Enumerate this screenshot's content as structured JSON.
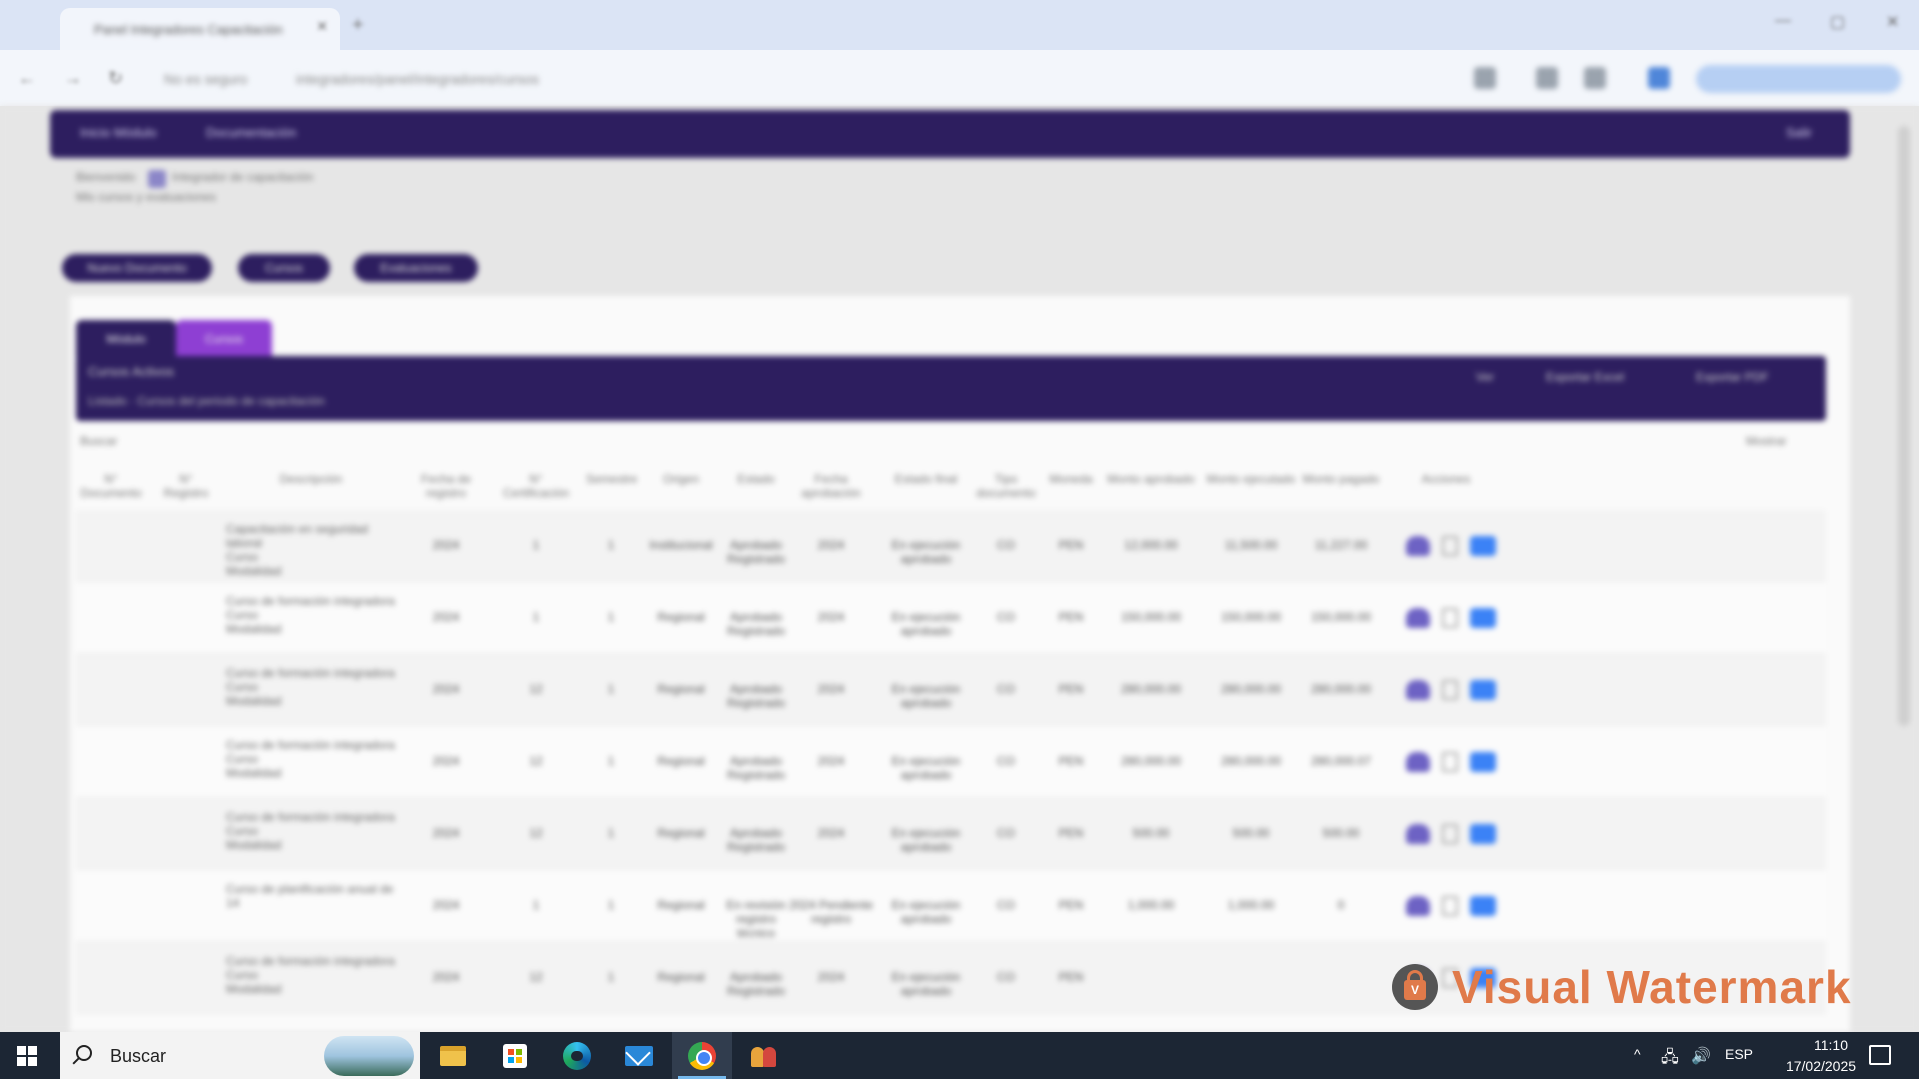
{
  "browser": {
    "tab_title": "Panel Integradores Capacitación",
    "tab_close": "✕",
    "new_tab": "+",
    "window_controls": [
      "—",
      "▢",
      "✕"
    ],
    "nav": {
      "back": "←",
      "forward": "→",
      "reload": "↻"
    },
    "url_prefix": "No es seguro",
    "url": "integradores/panel/integradores/cursos"
  },
  "app": {
    "nav_items": [
      "Inicio Módulo",
      "Documentación"
    ],
    "nav_right": "Salir",
    "info_lines": [
      "Bienvenido",
      "Integrador de capacitación",
      "Mis cursos y evaluaciones"
    ],
    "action_buttons": [
      "Nuevo Documento",
      "Cursos",
      "Evaluaciones"
    ],
    "subtabs": [
      "Módulo",
      "Cursos"
    ],
    "banner_title": "Cursos Activos",
    "banner_subtitle": "Listado · Cursos del periodo de capacitación",
    "banner_actions": [
      "Ver",
      "Exportar Excel",
      "Exportar PDF"
    ],
    "filter_label": "Buscar",
    "filter_right": "Mostrar",
    "headers": [
      "N° Documento",
      "N° Registro",
      "Descripción",
      "Fecha de registro",
      "N° Certificación",
      "Semestre",
      "Origen",
      "Estado",
      "Fecha aprobación",
      "Estado final",
      "Tipo documento",
      "Moneda",
      "Monto aprobado",
      "Monto ejecutado",
      "Monto pagado",
      "Acciones"
    ],
    "rows": [
      {
        "desc": [
          "Capacitación en seguridad laboral",
          "Curso",
          "Modalidad"
        ],
        "fecha": "2024",
        "cert": "1",
        "sem": "1",
        "origen": "Institucional",
        "estado": "Aprobado Registrado",
        "fecha_ap": "2024",
        "estado_final": "En ejecución aprobado",
        "tipo": "CO",
        "moneda": "PEN",
        "m1": "12,000.00",
        "m2": "11,500.00",
        "m3": "11,227.00"
      },
      {
        "desc": [
          "Curso de formación integradora",
          "Curso",
          "Modalidad"
        ],
        "fecha": "2024",
        "cert": "1",
        "sem": "1",
        "origen": "Regional",
        "estado": "Aprobado Registrado",
        "fecha_ap": "2024",
        "estado_final": "En ejecución aprobado",
        "tipo": "CO",
        "moneda": "PEN",
        "m1": "150,000.00",
        "m2": "150,000.00",
        "m3": "150,000.00"
      },
      {
        "desc": [
          "Curso de formación integradora",
          "Curso",
          "Modalidad"
        ],
        "fecha": "2024",
        "cert": "12",
        "sem": "1",
        "origen": "Regional",
        "estado": "Aprobado Registrado",
        "fecha_ap": "2024",
        "estado_final": "En ejecución aprobado",
        "tipo": "CO",
        "moneda": "PEN",
        "m1": "280,000.00",
        "m2": "280,000.00",
        "m3": "280,000.00"
      },
      {
        "desc": [
          "Curso de formación integradora",
          "Curso",
          "Modalidad"
        ],
        "fecha": "2024",
        "cert": "12",
        "sem": "1",
        "origen": "Regional",
        "estado": "Aprobado Registrado",
        "fecha_ap": "2024",
        "estado_final": "En ejecución aprobado",
        "tipo": "CO",
        "moneda": "PEN",
        "m1": "280,000.00",
        "m2": "280,000.00",
        "m3": "280,000.07"
      },
      {
        "desc": [
          "Curso de formación integradora",
          "Curso",
          "Modalidad"
        ],
        "fecha": "2024",
        "cert": "12",
        "sem": "1",
        "origen": "Regional",
        "estado": "Aprobado Registrado",
        "fecha_ap": "2024",
        "estado_final": "En ejecución aprobado",
        "tipo": "CO",
        "moneda": "PEN",
        "m1": "500.00",
        "m2": "500.00",
        "m3": "500.00"
      },
      {
        "desc": [
          "Curso de planificación anual de",
          "14"
        ],
        "fecha": "2024",
        "cert": "1",
        "sem": "1",
        "origen": "Regional",
        "estado": "En revisión registro técnico",
        "fecha_ap": "2024 Pendiente registro",
        "estado_final": "En ejecución aprobado",
        "tipo": "CO",
        "moneda": "PEN",
        "m1": "1,000.00",
        "m2": "1,000.00",
        "m3": "0"
      },
      {
        "desc": [
          "Curso de formación integradora",
          "Curso",
          "Modalidad"
        ],
        "fecha": "2024",
        "cert": "12",
        "sem": "1",
        "origen": "Regional",
        "estado": "Aprobado Registrado",
        "fecha_ap": "2024",
        "estado_final": "En ejecución aprobado",
        "tipo": "CO",
        "moneda": "PEN",
        "m1": "",
        "m2": "",
        "m3": ""
      }
    ]
  },
  "watermark": {
    "text": "Visual Watermark",
    "badge_letter": "V"
  },
  "taskbar": {
    "search_placeholder": "Buscar",
    "tray_chevron": "^",
    "language": "ESP",
    "time": "11:10",
    "date": "17/02/2025"
  },
  "colors": {
    "brand": "#2d1e5f",
    "accent": "#8e3fd3",
    "watermark": "#e07a4a",
    "taskbar": "#1c2634"
  }
}
